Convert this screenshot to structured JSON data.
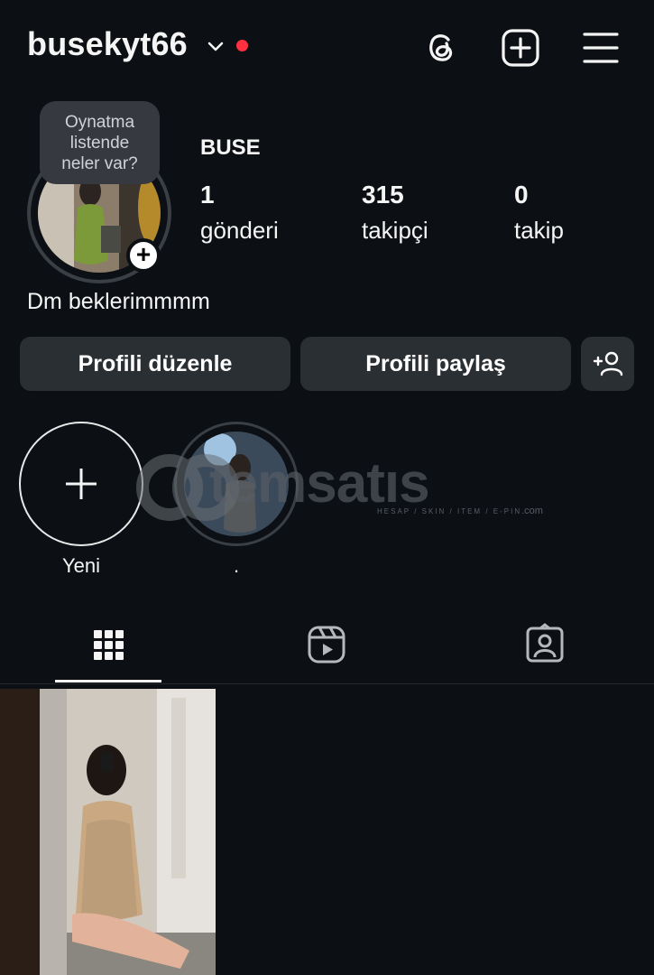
{
  "header": {
    "username": "busekyt66",
    "icons": [
      "chevron-down-icon",
      "threads-icon",
      "new-post-icon",
      "menu-icon"
    ],
    "notification_color": "#ff3040"
  },
  "profile": {
    "name": "BUSE",
    "bubble": [
      "Oynatma",
      "listende",
      "neler var?"
    ],
    "bio": "Dm beklerimmmm",
    "stats": [
      {
        "value": "1",
        "label": "gönderi"
      },
      {
        "value": "315",
        "label": "takipçi"
      },
      {
        "value": "0",
        "label": "takip"
      }
    ]
  },
  "buttons": {
    "edit": "Profili düzenle",
    "share": "Profili paylaş"
  },
  "highlights": [
    {
      "label": "Yeni"
    },
    {
      "label": "."
    }
  ],
  "watermark": {
    "text": "temsatıs",
    "sub": "HESAP / SKIN / ITEM / E-PIN",
    "suffix": ".com"
  },
  "tabs": [
    "grid-icon",
    "reels-icon",
    "tagged-icon"
  ],
  "colors": {
    "background": "#0c1014",
    "button": "#2a2f34",
    "accent": "#ff3040"
  }
}
